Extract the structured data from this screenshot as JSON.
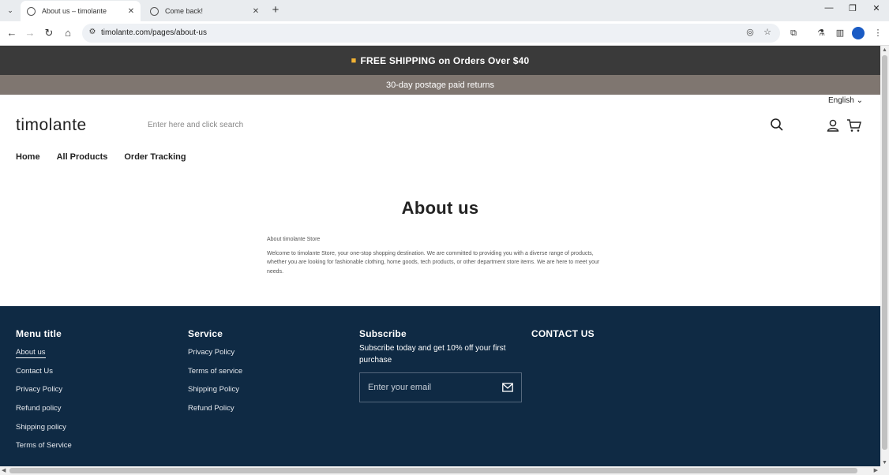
{
  "browser": {
    "tabs": [
      {
        "title": "About us – timolante",
        "active": true
      },
      {
        "title": "Come back!",
        "active": false
      }
    ],
    "url": "timolante.com/pages/about-us"
  },
  "announcements": {
    "primary": "FREE SHIPPING on Orders Over $40",
    "secondary": "30-day postage paid returns"
  },
  "header": {
    "language": "English",
    "logo": "timolante",
    "search_placeholder": "Enter here and click search"
  },
  "nav": {
    "items": [
      "Home",
      "All Products",
      "Order Tracking"
    ]
  },
  "main": {
    "title": "About us",
    "subtitle": "About timolante Store",
    "body": "Welcome to timolante Store, your one-stop shopping destination. We are committed to providing you with a diverse range of products, whether you are looking for fashionable clothing, home goods, tech products, or other department store items. We are here to meet your needs."
  },
  "footer": {
    "menu": {
      "title": "Menu title",
      "links": [
        "About us",
        "Contact Us",
        "Privacy Policy",
        "Refund policy",
        "Shipping policy",
        "Terms of Service"
      ]
    },
    "service": {
      "title": "Service",
      "links": [
        "Privacy Policy",
        "Terms of service",
        "Shipping Policy",
        "Refund Policy"
      ]
    },
    "subscribe": {
      "title": "Subscribe",
      "text": "Subscribe today and get 10% off your first purchase",
      "email_placeholder": "Enter your email"
    },
    "contact": {
      "title": "CONTACT US"
    }
  },
  "colors": {
    "announce_primary_bg": "#3a3a3a",
    "announce_secondary_bg": "#7f7670",
    "footer_bg": "#0f2a44"
  }
}
